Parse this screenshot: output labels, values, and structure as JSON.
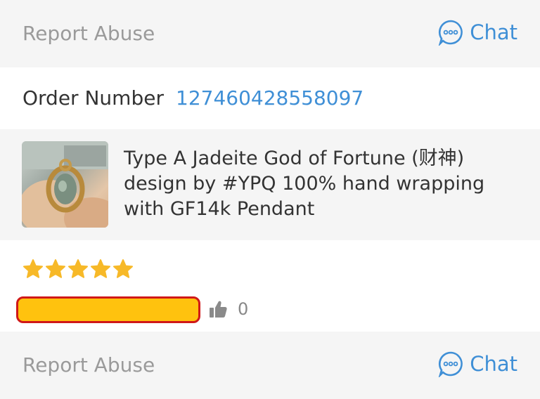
{
  "header": {
    "report_label": "Report Abuse",
    "chat_label": "Chat",
    "chat_icon": "chat-bubble-icon",
    "accent": "#3f8fd6"
  },
  "order": {
    "label": "Order Number",
    "number": "127460428558097"
  },
  "product": {
    "title": "Type A Jadeite God of Fortune (财神) design by #YPQ 100% hand wrapping with GF14k Pendant",
    "thumbnail": "jade-pendant-photo"
  },
  "review": {
    "rating": 5,
    "rating_max": 5,
    "star_color": "#f7b928",
    "like_count": "0",
    "like_icon": "thumbs-up-icon",
    "redaction_color": "#ffc20e"
  },
  "footer": {
    "report_label": "Report Abuse",
    "chat_label": "Chat"
  }
}
